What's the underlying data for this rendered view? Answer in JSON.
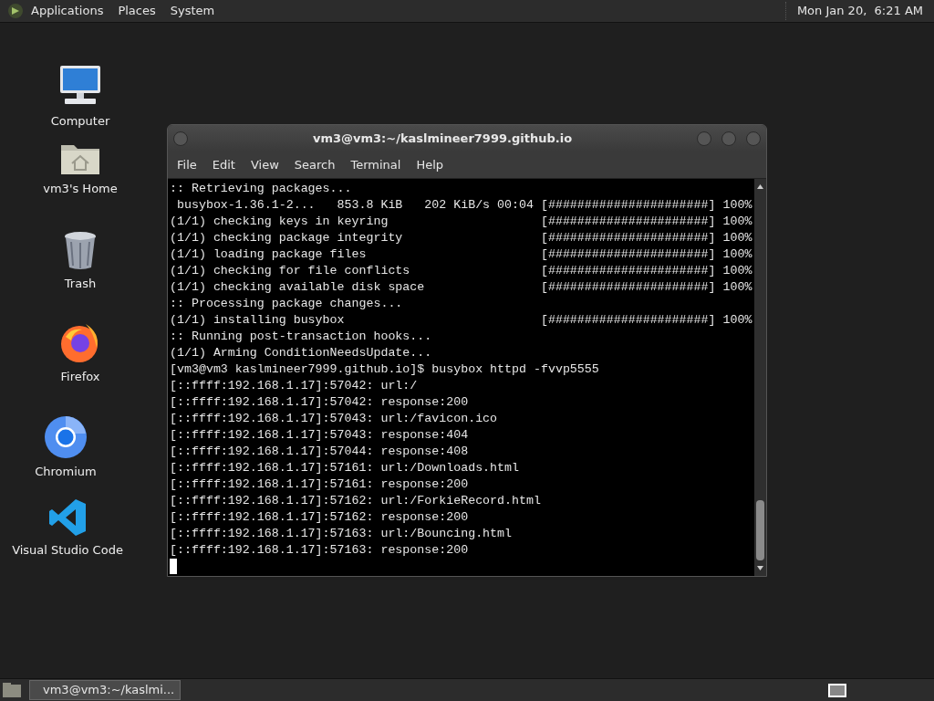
{
  "top_panel": {
    "menus": [
      "Applications",
      "Places",
      "System"
    ],
    "clock": "Mon Jan 20,  6:21 AM"
  },
  "desktop_icons": [
    {
      "kind": "computer",
      "label": "Computer"
    },
    {
      "kind": "home",
      "label": "vm3's Home"
    },
    {
      "kind": "trash",
      "label": "Trash"
    },
    {
      "kind": "firefox",
      "label": "Firefox"
    },
    {
      "kind": "chromium",
      "label": "Chromium"
    },
    {
      "kind": "vscode",
      "label": "Visual Studio Code"
    }
  ],
  "terminal_window": {
    "title": "vm3@vm3:~/kaslmineer7999.github.io",
    "menu": [
      "File",
      "Edit",
      "View",
      "Search",
      "Terminal",
      "Help"
    ],
    "lines": [
      ":: Retrieving packages...",
      " busybox-1.36.1-2...   853.8 KiB   202 KiB/s 00:04 [######################] 100%",
      "(1/1) checking keys in keyring                     [######################] 100%",
      "(1/1) checking package integrity                   [######################] 100%",
      "(1/1) loading package files                        [######################] 100%",
      "(1/1) checking for file conflicts                  [######################] 100%",
      "(1/1) checking available disk space                [######################] 100%",
      ":: Processing package changes...",
      "(1/1) installing busybox                           [######################] 100%",
      ":: Running post-transaction hooks...",
      "(1/1) Arming ConditionNeedsUpdate...",
      "[vm3@vm3 kaslmineer7999.github.io]$ busybox httpd -fvvp5555",
      "[::ffff:192.168.1.17]:57042: url:/",
      "[::ffff:192.168.1.17]:57042: response:200",
      "[::ffff:192.168.1.17]:57043: url:/favicon.ico",
      "[::ffff:192.168.1.17]:57043: response:404",
      "[::ffff:192.168.1.17]:57044: response:408",
      "[::ffff:192.168.1.17]:57161: url:/Downloads.html",
      "[::ffff:192.168.1.17]:57161: response:200",
      "[::ffff:192.168.1.17]:57162: url:/ForkieRecord.html",
      "[::ffff:192.168.1.17]:57162: response:200",
      "[::ffff:192.168.1.17]:57163: url:/Bouncing.html",
      "[::ffff:192.168.1.17]:57163: response:200"
    ]
  },
  "taskbar": {
    "tasks": [
      {
        "label": "vm3@vm3:~/kaslmi...",
        "selected": true
      }
    ]
  }
}
